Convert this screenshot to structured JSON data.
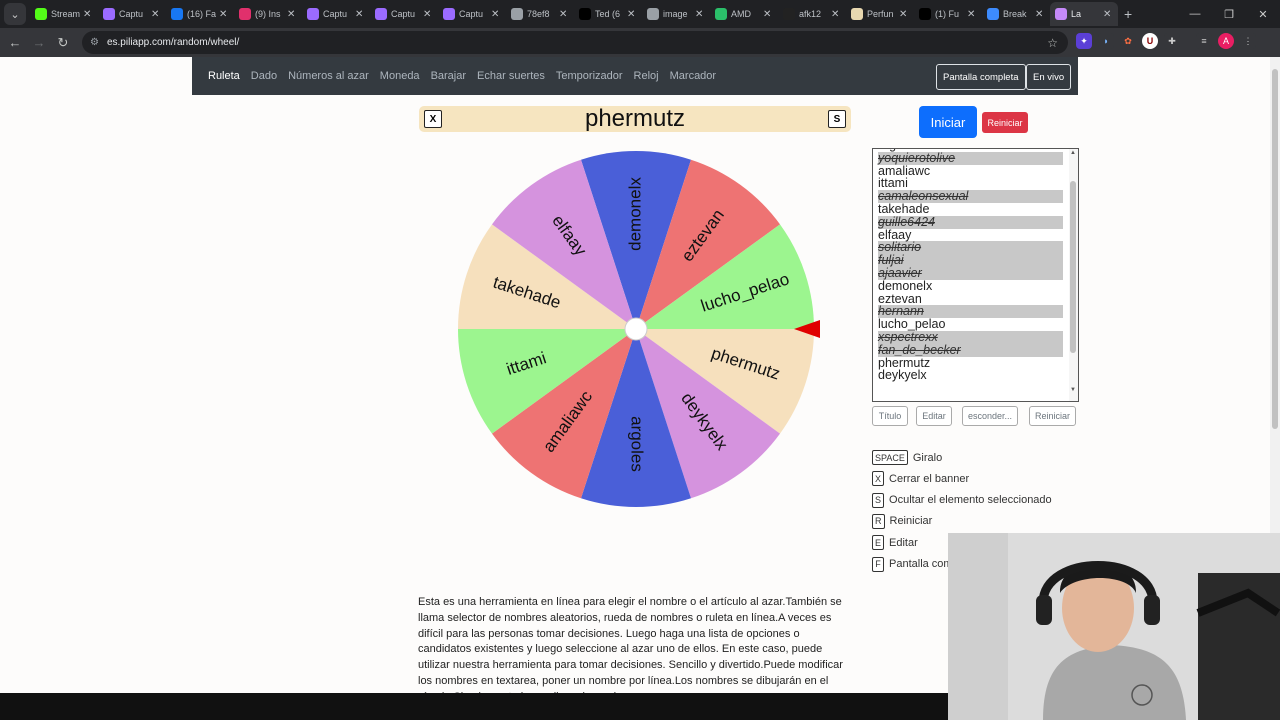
{
  "browser": {
    "tabs": [
      {
        "label": "Stream",
        "color": "#53fc18",
        "active": false
      },
      {
        "label": "Captu",
        "color": "#9b6bff",
        "active": false
      },
      {
        "label": "(16) Fa",
        "color": "#1877f2",
        "active": false
      },
      {
        "label": "(9) Ins",
        "color": "#e1306c",
        "active": false
      },
      {
        "label": "Captu",
        "color": "#9b6bff",
        "active": false
      },
      {
        "label": "Captu",
        "color": "#9b6bff",
        "active": false
      },
      {
        "label": "Captu",
        "color": "#9b6bff",
        "active": false
      },
      {
        "label": "78ef8",
        "color": "#9aa0a6",
        "active": false
      },
      {
        "label": "Ted (6",
        "color": "#000000",
        "active": false
      },
      {
        "label": "image",
        "color": "#9aa0a6",
        "active": false
      },
      {
        "label": "AMD",
        "color": "#2bbf6a",
        "active": false
      },
      {
        "label": "afk12",
        "color": "#222222",
        "active": false
      },
      {
        "label": "Perfun",
        "color": "#e8d8b0",
        "active": false
      },
      {
        "label": "(1) Fu",
        "color": "#000000",
        "active": false
      },
      {
        "label": "Break",
        "color": "#3d8bfd",
        "active": false
      },
      {
        "label": "La",
        "color": "#c58af9",
        "active": true
      }
    ],
    "url": "es.piliapp.com/random/wheel/"
  },
  "nav": {
    "links": [
      "Ruleta",
      "Dado",
      "Números al azar",
      "Moneda",
      "Barajar",
      "Echar suertes",
      "Temporizador",
      "Reloj",
      "Marcador"
    ],
    "fullscreen": "Pantalla completa",
    "live": "En vivo"
  },
  "banner": {
    "close_key": "X",
    "title": "phermutz",
    "hide_key": "S"
  },
  "wheel": {
    "segments": [
      {
        "name": "demonelx",
        "color": "#4a5fd8"
      },
      {
        "name": "eztevan",
        "color": "#ee7373"
      },
      {
        "name": "lucho_pelao",
        "color": "#9cf58f"
      },
      {
        "name": "phermutz",
        "color": "#f6e0bd"
      },
      {
        "name": "deykyelx",
        "color": "#d593de"
      },
      {
        "name": "argoles",
        "color": "#4a5fd8"
      },
      {
        "name": "amaliawc",
        "color": "#ee7373"
      },
      {
        "name": "ittami",
        "color": "#9cf58f"
      },
      {
        "name": "takehade",
        "color": "#f6e0bd"
      },
      {
        "name": "elfaay",
        "color": "#d593de"
      }
    ],
    "pointer_color": "#e00000"
  },
  "controls": {
    "start": "Iniciar",
    "reset": "Reiniciar"
  },
  "names": [
    {
      "name": "argoles",
      "removed": false
    },
    {
      "name": "yoquierotolive",
      "removed": true
    },
    {
      "name": "amaliawc",
      "removed": false
    },
    {
      "name": "ittami",
      "removed": false
    },
    {
      "name": "camaleonsexual",
      "removed": true
    },
    {
      "name": "takehade",
      "removed": false
    },
    {
      "name": "guille6424",
      "removed": true
    },
    {
      "name": "elfaay",
      "removed": false
    },
    {
      "name": "solitario",
      "removed": true
    },
    {
      "name": "fuljai",
      "removed": true
    },
    {
      "name": "ajaavier",
      "removed": true
    },
    {
      "name": "demonelx",
      "removed": false
    },
    {
      "name": "eztevan",
      "removed": false
    },
    {
      "name": "hernann",
      "removed": true
    },
    {
      "name": "lucho_pelao",
      "removed": false
    },
    {
      "name": "xspectrexx",
      "removed": true
    },
    {
      "name": "fan_de_becker",
      "removed": true
    },
    {
      "name": "phermutz",
      "removed": false
    },
    {
      "name": "deykyelx",
      "removed": false
    }
  ],
  "list_buttons": {
    "title": "Título",
    "edit": "Editar",
    "hide": "esconder...",
    "reset": "Reiniciar"
  },
  "shortcuts": [
    {
      "key": "SPACE",
      "label": "Giralo"
    },
    {
      "key": "X",
      "label": "Cerrar el banner"
    },
    {
      "key": "S",
      "label": "Ocultar el elemento seleccionado"
    },
    {
      "key": "R",
      "label": "Reiniciar"
    },
    {
      "key": "E",
      "label": "Editar"
    },
    {
      "key": "F",
      "label": "Pantalla com"
    }
  ],
  "description": "Esta es una herramienta en línea para elegir el nombre o el artículo al azar.También se llama selector de nombres aleatorios, rueda de nombres o ruleta en línea.A veces es difícil para las personas tomar decisiones. Luego haga una lista de opciones o candidatos existentes y luego seleccione al azar uno de ellos. En este caso, puede utilizar nuestra herramienta para tomar decisiones. Sencillo y divertido.Puede modificar los nombres en textarea, poner un nombre por línea.Los nombres se dibujarán en el círculo.Simplemente haga clic en la rueda"
}
